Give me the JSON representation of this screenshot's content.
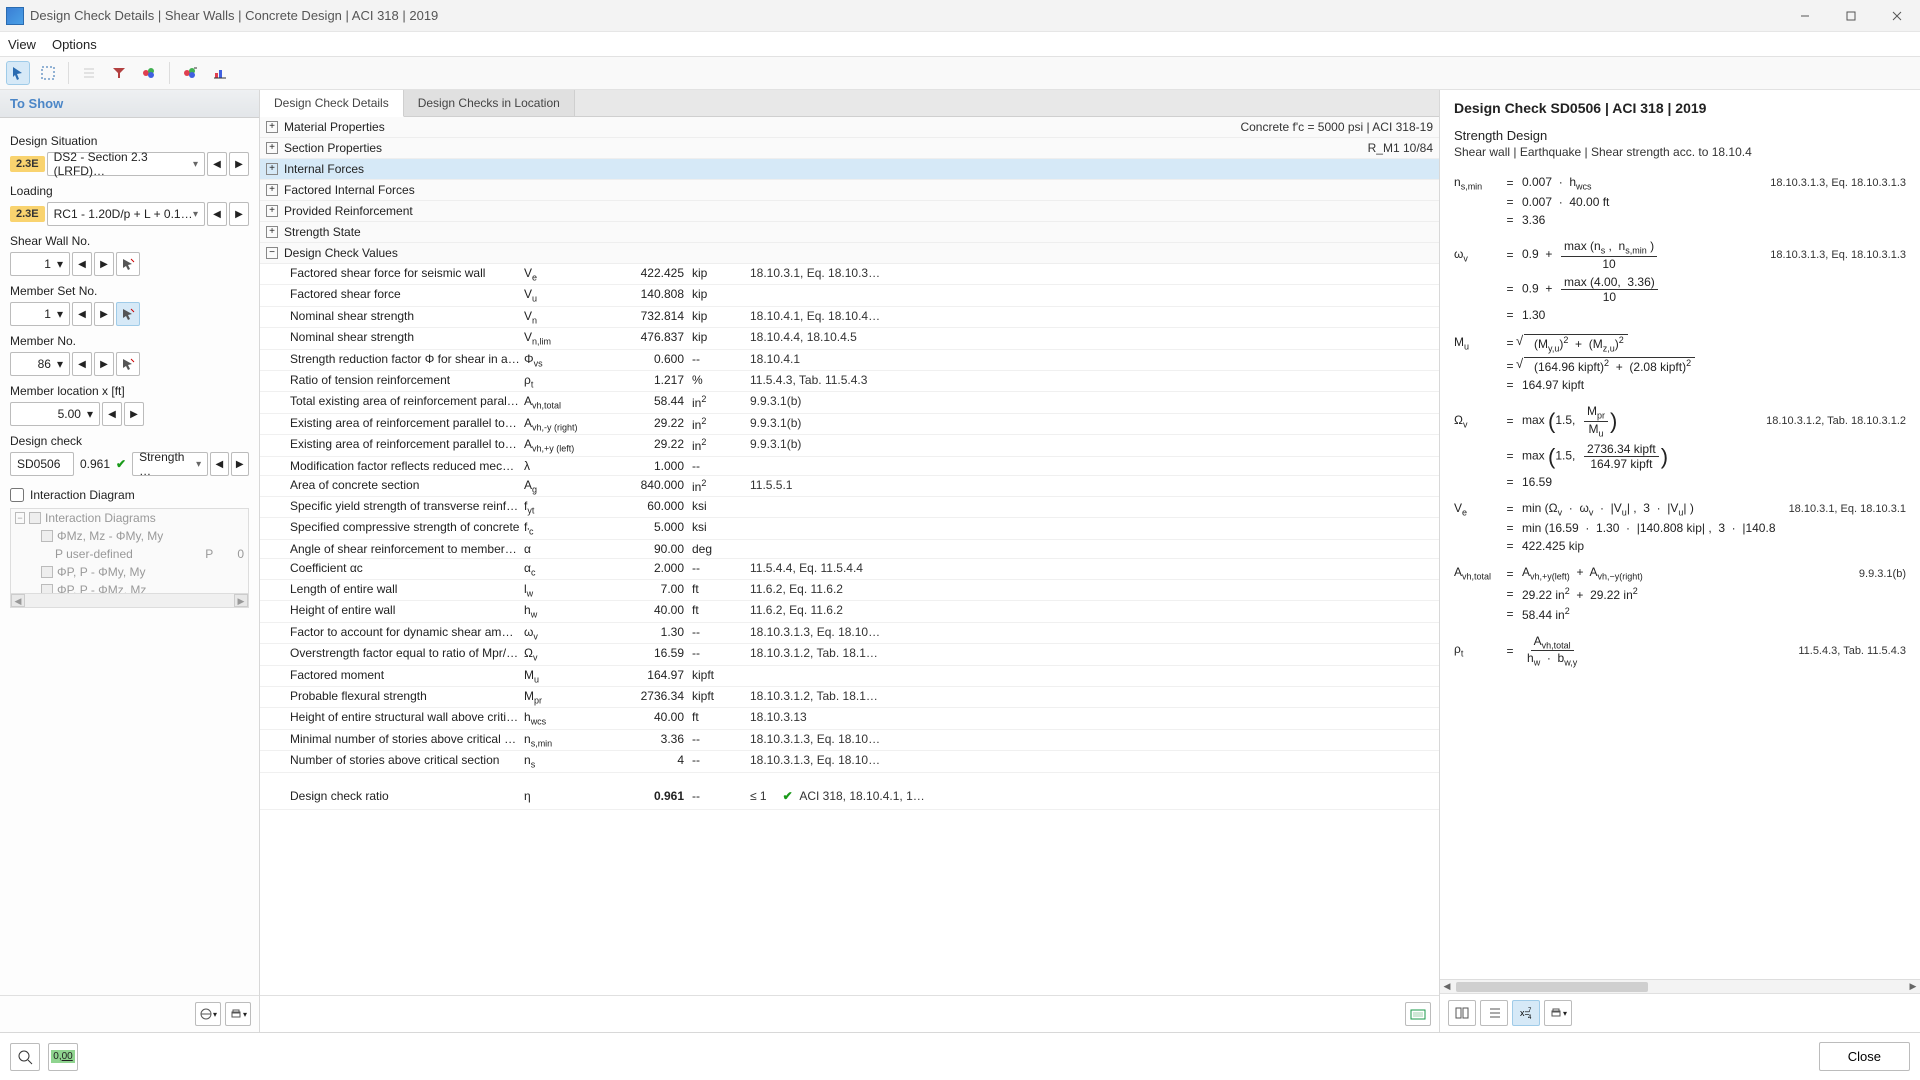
{
  "window": {
    "title": "Design Check Details | Shear Walls | Concrete Design | ACI 318 | 2019"
  },
  "menus": [
    "View",
    "Options"
  ],
  "left": {
    "header": "To Show",
    "design_situation_label": "Design Situation",
    "design_situation_badge": "2.3E",
    "design_situation_value": "DS2 - Section 2.3 (LRFD)…",
    "loading_label": "Loading",
    "loading_badge": "2.3E",
    "loading_value": "RC1 - 1.20D/p + L + 0.1…",
    "shear_wall_label": "Shear Wall No.",
    "shear_wall_value": "1",
    "member_set_label": "Member Set No.",
    "member_set_value": "1",
    "member_no_label": "Member No.",
    "member_no_value": "86",
    "member_loc_label": "Member location x [ft]",
    "member_loc_value": "5.00",
    "design_check_label": "Design check",
    "design_check_id": "SD0506",
    "design_check_ratio": "0.961",
    "design_check_type": "Strength …",
    "interaction_label": "Interaction Diagram",
    "tree": {
      "root": "Interaction Diagrams",
      "items": [
        {
          "label": "ΦMz, Mz - ΦMy, My"
        },
        {
          "label": "P user-defined",
          "p": "P",
          "v": "0"
        },
        {
          "label": "ΦP, P - ΦMy, My"
        },
        {
          "label": "ΦP, P - ΦMz, Mz"
        }
      ]
    }
  },
  "center": {
    "tabs": [
      "Design Check Details",
      "Design Checks in Location"
    ],
    "sections": [
      {
        "name": "Material Properties",
        "right": "Concrete f'c = 5000 psi | ACI 318-19",
        "exp": "+"
      },
      {
        "name": "Section Properties",
        "right": "R_M1 10/84",
        "exp": "+"
      },
      {
        "name": "Internal Forces",
        "exp": "+",
        "sel": true
      },
      {
        "name": "Factored Internal Forces",
        "exp": "+"
      },
      {
        "name": "Provided Reinforcement",
        "exp": "+"
      },
      {
        "name": "Strength State",
        "exp": "+"
      },
      {
        "name": "Design Check Values",
        "exp": "−"
      }
    ],
    "rows": [
      {
        "name": "Factored shear force for seismic wall",
        "sym": "Ve",
        "val": "422.425",
        "unit": "kip",
        "ref": "18.10.3.1, Eq. 18.10.3…"
      },
      {
        "name": "Factored shear force",
        "sym": "Vu",
        "val": "140.808",
        "unit": "kip",
        "ref": ""
      },
      {
        "name": "Nominal shear strength",
        "sym": "Vn",
        "val": "732.814",
        "unit": "kip",
        "ref": "18.10.4.1, Eq. 18.10.4…"
      },
      {
        "name": "Nominal shear strength",
        "sym": "Vn,lim",
        "val": "476.837",
        "unit": "kip",
        "ref": "18.10.4.4, 18.10.4.5"
      },
      {
        "name": "Strength reduction factor Φ for shear in a seis…",
        "sym": "Φvs",
        "val": "0.600",
        "unit": "--",
        "ref": "18.10.4.1"
      },
      {
        "name": "Ratio of tension reinforcement",
        "sym": "ρt",
        "val": "1.217",
        "unit": "%",
        "ref": "11.5.4.3, Tab. 11.5.4.3"
      },
      {
        "name": "Total existing area of reinforcement parallel to …",
        "sym": "Avh,total",
        "val": "58.44",
        "unit": "in²",
        "ref": "9.9.3.1(b)"
      },
      {
        "name": "Existing area of reinforcement parallel to longi…",
        "sym": "Avh,-y (right)",
        "val": "29.22",
        "unit": "in²",
        "ref": "9.9.3.1(b)"
      },
      {
        "name": "Existing area of reinforcement parallel to longi…",
        "sym": "Avh,+y (left)",
        "val": "29.22",
        "unit": "in²",
        "ref": "9.9.3.1(b)"
      },
      {
        "name": "Modification factor reflects reduced mechanic…",
        "sym": "λ",
        "val": "1.000",
        "unit": "--",
        "ref": ""
      },
      {
        "name": "Area of concrete section",
        "sym": "Ag",
        "val": "840.000",
        "unit": "in²",
        "ref": "11.5.5.1"
      },
      {
        "name": "Specific yield strength of transverse reinforce…",
        "sym": "fyt",
        "val": "60.000",
        "unit": "ksi",
        "ref": ""
      },
      {
        "name": "Specified compressive strength of concrete",
        "sym": "f'c",
        "val": "5.000",
        "unit": "ksi",
        "ref": ""
      },
      {
        "name": "Angle of shear reinforcement to member axis",
        "sym": "α",
        "val": "90.00",
        "unit": "deg",
        "ref": ""
      },
      {
        "name": "Coefficient αc",
        "sym": "αc",
        "val": "2.000",
        "unit": "--",
        "ref": "11.5.4.4, Eq. 11.5.4.4"
      },
      {
        "name": "Length of entire wall",
        "sym": "lw",
        "val": "7.00",
        "unit": "ft",
        "ref": "11.6.2, Eq. 11.6.2"
      },
      {
        "name": "Height of entire wall",
        "sym": "hw",
        "val": "40.00",
        "unit": "ft",
        "ref": "11.6.2, Eq. 11.6.2"
      },
      {
        "name": "Factor to account for dynamic shear amplificat…",
        "sym": "ωv",
        "val": "1.30",
        "unit": "--",
        "ref": "18.10.3.1.3, Eq. 18.10…"
      },
      {
        "name": "Overstrength factor equal to ratio of Mpr/Mu a…",
        "sym": "Ωv",
        "val": "16.59",
        "unit": "--",
        "ref": "18.10.3.1.2, Tab. 18.1…"
      },
      {
        "name": "Factored moment",
        "sym": "Mu",
        "val": "164.97",
        "unit": "kipft",
        "ref": ""
      },
      {
        "name": "Probable flexural strength",
        "sym": "Mpr",
        "val": "2736.34",
        "unit": "kipft",
        "ref": "18.10.3.1.2, Tab. 18.1…"
      },
      {
        "name": "Height of entire structural wall above critical s…",
        "sym": "hwcs",
        "val": "40.00",
        "unit": "ft",
        "ref": "18.10.3.13"
      },
      {
        "name": "Minimal number of stories above critical secti…",
        "sym": "ns,min",
        "val": "3.36",
        "unit": "--",
        "ref": "18.10.3.1.3, Eq. 18.10…"
      },
      {
        "name": "Number of stories above critical section",
        "sym": "ns",
        "val": "4",
        "unit": "--",
        "ref": "18.10.3.1.3, Eq. 18.10…"
      }
    ],
    "final": {
      "name": "Design check ratio",
      "sym": "η",
      "val": "0.961",
      "unit": "--",
      "limit": "≤ 1",
      "ref": "ACI 318, 18.10.4.1, 1…"
    }
  },
  "right": {
    "title": "Design Check SD0506 | ACI 318 | 2019",
    "h2": "Strength Design",
    "sub": "Shear wall | Earthquake | Shear strength acc. to 18.10.4",
    "refs": {
      "nsmin": "18.10.3.1.3, Eq. 18.10.3.1.3",
      "wv": "18.10.3.1.3, Eq. 18.10.3.1.3",
      "ov": "18.10.3.1.2, Tab. 18.10.3.1.2",
      "ve": "18.10.3.1, Eq. 18.10.3.1",
      "avh": "9.9.3.1(b)",
      "pt": "11.5.4.3, Tab. 11.5.4.3"
    }
  },
  "footer": {
    "close": "Close"
  }
}
